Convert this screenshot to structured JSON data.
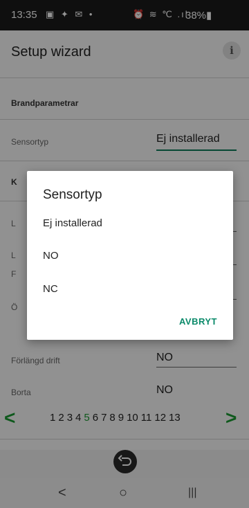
{
  "status": {
    "time": "13:35",
    "left_icons": "▣ ✦ ✉ •",
    "right_icons": "⏰ ≋ ℃ .ıl",
    "battery": "38%▮"
  },
  "app": {
    "title": "Setup wizard",
    "info_icon": "i",
    "section_fire": "Brandparametrar",
    "sensor_label": "Sensortyp",
    "sensor_value": "Ej installerad",
    "hidden_section": "K",
    "row1_label": "L",
    "row2_label": "L",
    "row3_label": "F",
    "row4_label": "Ö",
    "extended_label": "Förlängd drift",
    "extended_value": "NO",
    "away_label": "Borta",
    "away_value": "NO"
  },
  "pager": {
    "prev": "<",
    "next": ">",
    "pages": [
      "1",
      "2",
      "3",
      "4",
      "5",
      "6",
      "7",
      "8",
      "9",
      "10",
      "11",
      "12",
      "13"
    ],
    "active_page": "5",
    "accent_color": "#1b9a33"
  },
  "dialog": {
    "title": "Sensortyp",
    "options": [
      "Ej installerad",
      "NO",
      "NC"
    ],
    "cancel": "AVBRYT"
  },
  "undo_icon": "undo-icon",
  "nav": {
    "back": "<",
    "home": "○",
    "recents": "|||"
  }
}
